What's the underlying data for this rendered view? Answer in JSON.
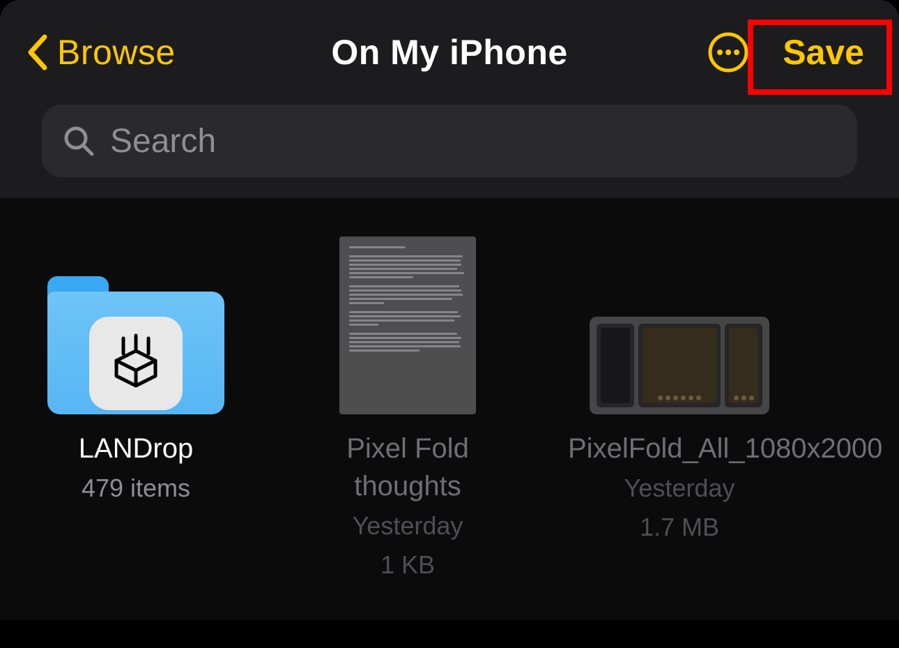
{
  "colors": {
    "accent": "#FFC700",
    "highlight": "#FF0000"
  },
  "nav": {
    "back_label": "Browse",
    "title": "On My iPhone",
    "save_label": "Save",
    "more_icon": "ellipsis-circle-icon"
  },
  "search": {
    "placeholder": "Search",
    "value": ""
  },
  "items": [
    {
      "kind": "folder",
      "name": "LANDrop",
      "subtitle": "479 items",
      "icon": "landrop-folder-icon",
      "enabled": true
    },
    {
      "kind": "document",
      "name": "Pixel Fold thoughts",
      "date": "Yesterday",
      "size": "1 KB",
      "enabled": false
    },
    {
      "kind": "image",
      "name": "PixelFold_All_1080x2000",
      "date": "Yesterday",
      "size": "1.7 MB",
      "enabled": false
    }
  ]
}
